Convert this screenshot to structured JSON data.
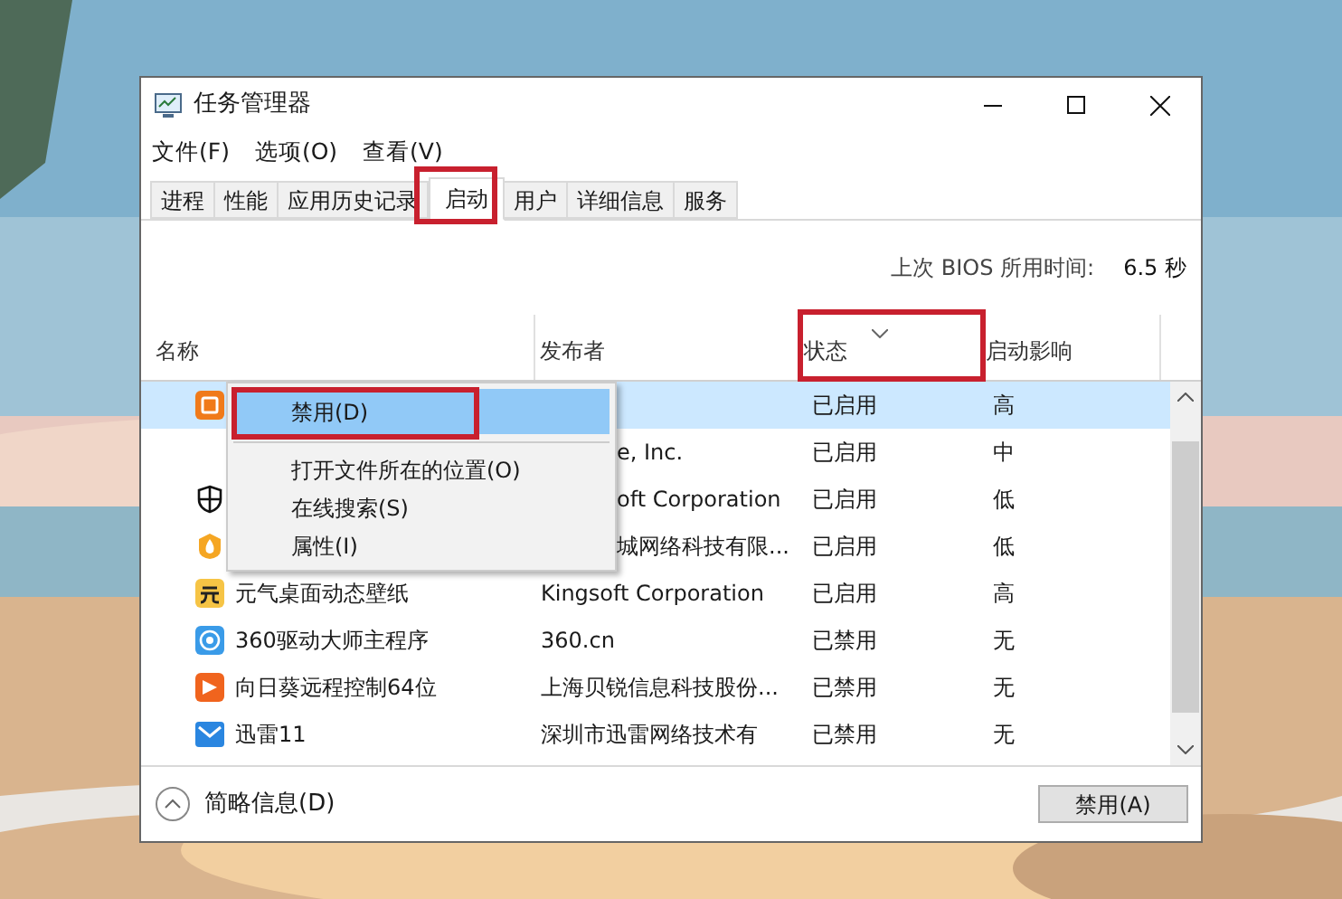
{
  "window": {
    "title": "任务管理器"
  },
  "menu_bar": [
    "文件(F)",
    "选项(O)",
    "查看(V)"
  ],
  "tabs": [
    {
      "label": "进程",
      "selected": false
    },
    {
      "label": "性能",
      "selected": false
    },
    {
      "label": "应用历史记录",
      "selected": false
    },
    {
      "label": "启动",
      "selected": true
    },
    {
      "label": "用户",
      "selected": false
    },
    {
      "label": "详细信息",
      "selected": false
    },
    {
      "label": "服务",
      "selected": false
    }
  ],
  "bios_time": {
    "label": "上次 BIOS 所用时间:",
    "value": "6.5 秒"
  },
  "table": {
    "columns": [
      {
        "label": "名称",
        "sorted": false
      },
      {
        "label": "发布者",
        "sorted": false
      },
      {
        "label": "状态",
        "sorted": true
      },
      {
        "label": "启动影响",
        "sorted": false
      }
    ],
    "rows": [
      {
        "kind": "orange-app",
        "status": "已启用",
        "impact": "高",
        "selected": true
      },
      {
        "kind": "none",
        "publisher": "e, Inc.",
        "status": "已启用",
        "impact": "中",
        "selected": false
      },
      {
        "kind": "shield",
        "publisher": "oft Corporation",
        "status": "已启用",
        "impact": "低",
        "selected": false
      },
      {
        "kind": "flame",
        "publisher": "城网络科技有限...",
        "status": "已启用",
        "impact": "低",
        "selected": false
      },
      {
        "kind": "yellow-app",
        "name": "元气桌面动态壁纸",
        "publisher": "Kingsoft Corporation",
        "status": "已启用",
        "impact": "高",
        "selected": false
      },
      {
        "kind": "disc",
        "name": "360驱动大师主程序",
        "publisher": "360.cn",
        "status": "已禁用",
        "impact": "无",
        "selected": false
      },
      {
        "kind": "play",
        "name": "向日葵远程控制64位",
        "publisher": "上海贝锐信息科技股份...",
        "status": "已禁用",
        "impact": "无",
        "selected": false
      },
      {
        "kind": "mail",
        "name": "迅雷11",
        "publisher": "深圳市迅雷网络技术有",
        "status": "已禁用",
        "impact": "无",
        "selected": false
      }
    ]
  },
  "context_menu": [
    {
      "label": "禁用(D)",
      "selected": true
    },
    {
      "label": "打开文件所在的位置(O)",
      "selected": false
    },
    {
      "label": "在线搜索(S)",
      "selected": false
    },
    {
      "label": "属性(I)",
      "selected": false
    }
  ],
  "footer": {
    "toggle": "简略信息(D)",
    "button": "禁用(A)"
  }
}
